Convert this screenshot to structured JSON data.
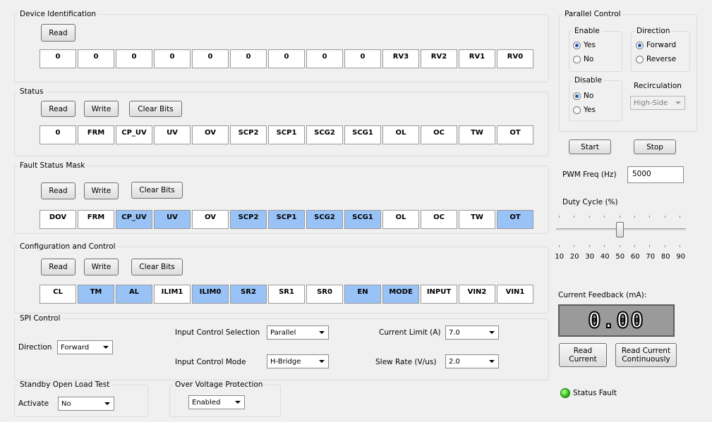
{
  "device_id": {
    "title": "Device Identification",
    "read": "Read",
    "bits": [
      "0",
      "0",
      "0",
      "0",
      "0",
      "0",
      "0",
      "0",
      "0",
      "RV3",
      "RV2",
      "RV1",
      "RV0"
    ]
  },
  "status": {
    "title": "Status",
    "read": "Read",
    "write": "Write",
    "clear": "Clear Bits",
    "bits": [
      "0",
      "FRM",
      "CP_UV",
      "UV",
      "OV",
      "SCP2",
      "SCP1",
      "SCG2",
      "SCG1",
      "OL",
      "OC",
      "TW",
      "OT"
    ]
  },
  "fault_mask": {
    "title": "Fault Status Mask",
    "read": "Read",
    "write": "Write",
    "clear": "Clear Bits",
    "bits": [
      "DOV",
      "FRM",
      "CP_UV",
      "UV",
      "OV",
      "SCP2",
      "SCP1",
      "SCG2",
      "SCG1",
      "OL",
      "OC",
      "TW",
      "OT"
    ],
    "active": [
      false,
      false,
      true,
      true,
      false,
      true,
      true,
      true,
      true,
      false,
      false,
      false,
      true
    ]
  },
  "config": {
    "title": "Configuration and Control",
    "read": "Read",
    "write": "Write",
    "clear": "Clear Bits",
    "bits": [
      "CL",
      "TM",
      "AL",
      "ILIM1",
      "ILIM0",
      "SR2",
      "SR1",
      "SR0",
      "EN",
      "MODE",
      "INPUT",
      "VIN2",
      "VIN1"
    ],
    "active": [
      false,
      true,
      true,
      false,
      true,
      true,
      false,
      false,
      true,
      true,
      false,
      false,
      false
    ]
  },
  "spi": {
    "title": "SPI Control",
    "direction_label": "Direction",
    "direction_value": "Forward",
    "input_sel_label": "Input Control Selection",
    "input_sel_value": "Parallel",
    "input_mode_label": "Input Control Mode",
    "input_mode_value": "H-Bridge",
    "current_limit_label": "Current Limit (A)",
    "current_limit_value": "7.0",
    "slew_label": "Slew Rate (V/us)",
    "slew_value": "2.0"
  },
  "standby": {
    "title": "Standby Open Load Test",
    "activate_label": "Activate",
    "activate_value": "No"
  },
  "ovp": {
    "title": "Over Voltage Protection",
    "value": "Enabled"
  },
  "parallel": {
    "title": "Parallel Control",
    "enable_title": "Enable",
    "enable_yes": "Yes",
    "enable_no": "No",
    "direction_title": "Direction",
    "dir_forward": "Forward",
    "dir_reverse": "Reverse",
    "disable_title": "Disable",
    "disable_no": "No",
    "disable_yes": "Yes",
    "recirc_title": "Recirculation",
    "recirc_value": "High-Side",
    "start": "Start",
    "stop": "Stop",
    "pwm_label": "PWM Freq (Hz)",
    "pwm_value": "5000",
    "duty_label": "Duty Cycle (%)",
    "duty_value": 50,
    "duty_scale": [
      "10",
      "20",
      "30",
      "40",
      "50",
      "60",
      "70",
      "80",
      "90"
    ]
  },
  "feedback": {
    "label": "Current Feedback (mA):",
    "value": "0.00",
    "read": "Read Current",
    "read_cont": "Read Current Continuously",
    "status_fault": "Status Fault"
  }
}
